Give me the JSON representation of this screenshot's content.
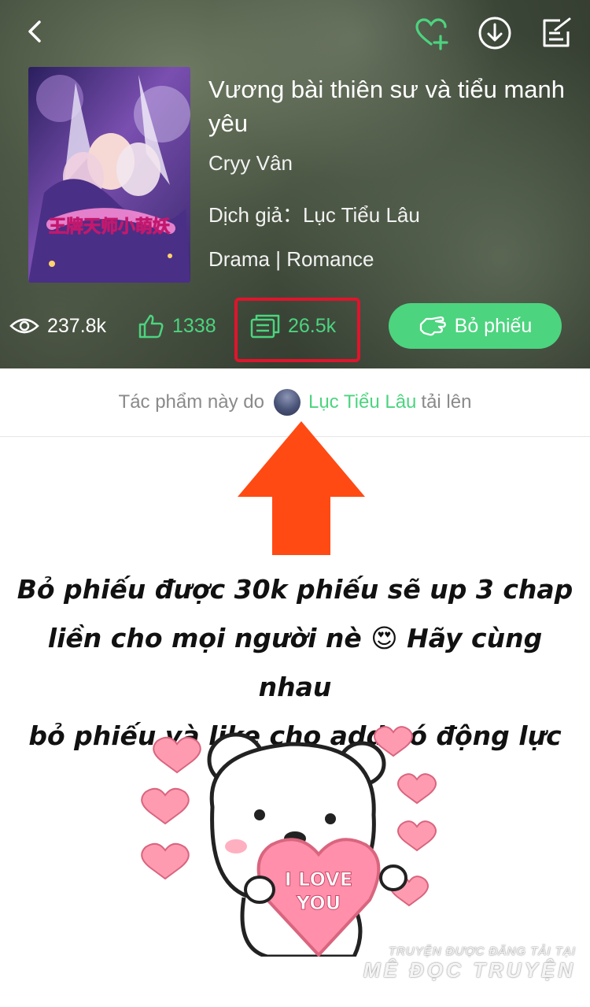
{
  "book": {
    "title": "Vương bài thiên sư và tiểu manh yêu",
    "author": "Cryy Vân",
    "translator_label": "Dịch giả：",
    "translator": "Lục Tiểu Lâu",
    "genre": "Drama | Romance",
    "cover_text": "王牌天师小萌妖"
  },
  "stats": {
    "views": "237.8k",
    "likes": "1338",
    "votes": "26.5k"
  },
  "vote_button": {
    "label": "Bỏ phiếu"
  },
  "uploader": {
    "prefix": "Tác phẩm này do",
    "name": "Lục Tiểu Lâu",
    "suffix": "tải lên"
  },
  "message": {
    "line1": "Bỏ phiếu được 30k phiếu sẽ up 3 chap",
    "line2": "liền cho mọi người nè 😍 Hãy cùng nhau",
    "line3": "bỏ phiếu và like cho add có động lực nhé !"
  },
  "sticker": {
    "heart_text_1": "I LOVE",
    "heart_text_2": "YOU"
  },
  "watermark": {
    "line1": "TRUYỆN ĐƯỢC ĐĂNG TẢI TẠI",
    "line2": "MÊ ĐỌC TRUYỆN"
  },
  "colors": {
    "accent": "#4cd47f",
    "highlight": "#e0142c",
    "arrow": "#ff4a14"
  }
}
